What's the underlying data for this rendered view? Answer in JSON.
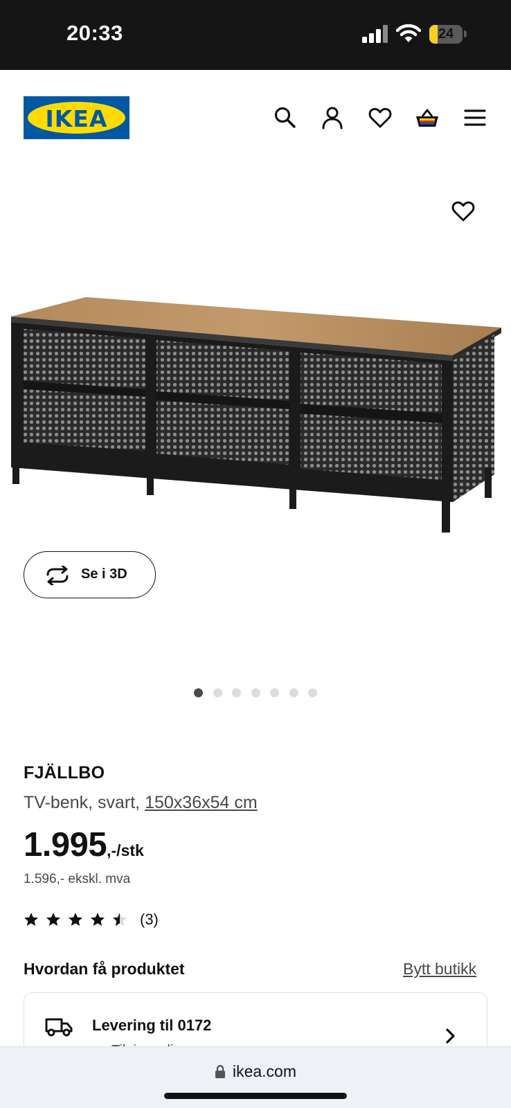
{
  "status_bar": {
    "time": "20:33",
    "battery_percent": "24",
    "battery_level": 0.24
  },
  "header": {
    "logo_text": "IKEA",
    "icons": [
      "search-icon",
      "account-icon",
      "favourites-heart-icon",
      "shopping-basket-icon",
      "menu-icon"
    ]
  },
  "gallery": {
    "view_3d_label": "Se i 3D",
    "image_count": 7,
    "active_index": 0
  },
  "product": {
    "name": "FJÄLLBO",
    "type": "TV-benk, svart,",
    "dimensions": "150x36x54 cm",
    "price_main": "1.995",
    "price_suffix": ",-/stk",
    "price_ex_vat": "1.596,- ekskl. mva",
    "rating_value": 4.5,
    "rating_max": 5,
    "review_count": "(3)"
  },
  "fulfillment": {
    "heading": "Hvordan få produktet",
    "change_store_label": "Bytt butikk",
    "delivery_title": "Levering til 0172",
    "delivery_status": "Tilgjengelig"
  },
  "browser": {
    "url": "ikea.com"
  },
  "colors": {
    "ikea_blue": "#0058a3",
    "ikea_yellow": "#ffdb00",
    "available_green": "#0a8a00"
  }
}
